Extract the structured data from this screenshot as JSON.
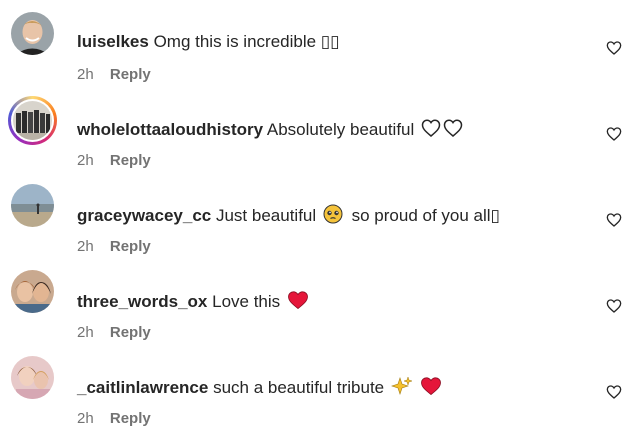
{
  "comments": [
    {
      "username": "luiselkes",
      "text": "Omg this is incredible ▯▯",
      "time": "2h",
      "reply": "Reply"
    },
    {
      "username": "wholelottaaloudhistory",
      "text": "Absolutely beautiful",
      "time": "2h",
      "reply": "Reply"
    },
    {
      "username": "graceywacey_cc",
      "text": "Just beautiful",
      "text2": "so proud of you all▯",
      "time": "2h",
      "reply": "Reply"
    },
    {
      "username": "three_words_ox",
      "text": "Love this",
      "time": "2h",
      "reply": "Reply"
    },
    {
      "username": "_caitlinlawrence",
      "text": "such a beautiful tribute",
      "time": "2h",
      "reply": "Reply"
    }
  ],
  "icons": {
    "like": "heart-outline-icon",
    "emoji_hearts_outline": "white-heart-emoji",
    "emoji_pleading": "pleading-face-emoji",
    "emoji_red_heart": "red-heart-emoji",
    "emoji_sparkles": "sparkles-emoji"
  },
  "colors": {
    "text": "#262626",
    "secondary": "#737373",
    "red_heart": "#e5163a"
  }
}
